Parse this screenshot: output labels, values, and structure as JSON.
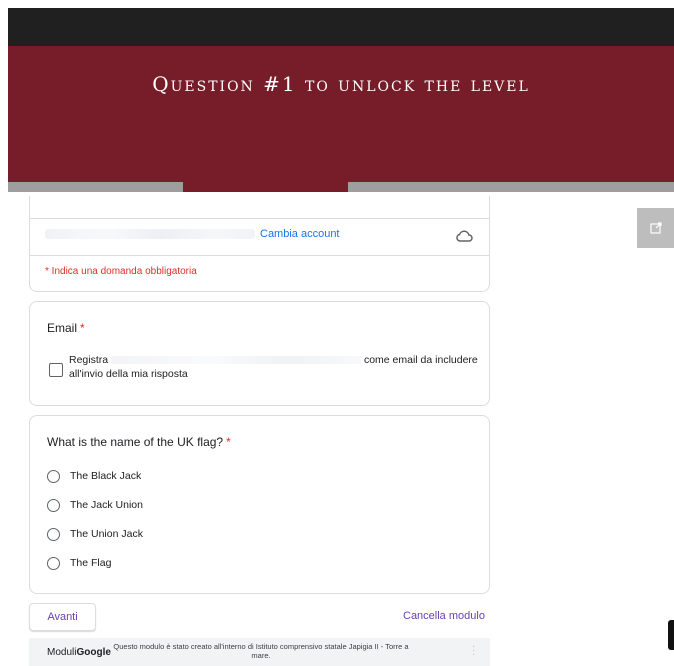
{
  "header": {
    "title": "Question #1 to unlock the level"
  },
  "account": {
    "change_account_label": "Cambia account",
    "cloud_icon": "cloud-icon"
  },
  "required_note": "* Indica una domanda obbligatoria",
  "email_question": {
    "title": "Email",
    "required_mark": "*",
    "checkbox_prefix": "Registra",
    "checkbox_suffix": "come email da includere all'invio della mia risposta",
    "checked": false
  },
  "question": {
    "title": "What is the name of the UK flag?",
    "required_mark": "*",
    "options": [
      "The Black Jack",
      "The Jack Union",
      "The Union Jack",
      "The Flag"
    ],
    "selected": null
  },
  "actions": {
    "next_label": "Avanti",
    "clear_label": "Cancella modulo"
  },
  "footer": {
    "logo_moduli": "Moduli",
    "logo_google": "Google",
    "text": "Questo modulo è stato creato all'interno di Istituto comprensivo statale Japigia II - Torre a mare."
  },
  "colors": {
    "banner": "#771c29",
    "accent": "#6a3fb4",
    "link": "#1a73e8",
    "required": "#d93025"
  }
}
